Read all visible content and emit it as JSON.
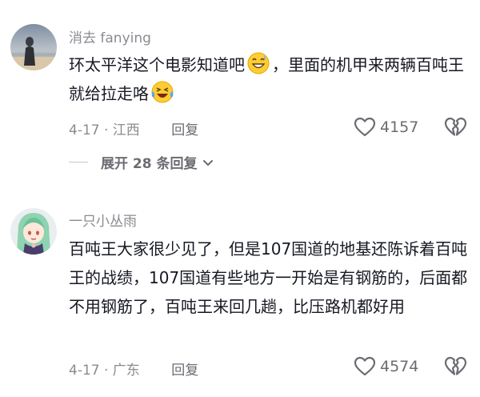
{
  "comments": [
    {
      "username": "消去 fanying",
      "text_part1": "环太平洋这个电影知道吧",
      "emoji1": "grinning-sweat-emoji",
      "text_part2": "，里面的机甲来两辆百吨王就给拉走咯",
      "emoji2": "laughing-crying-emoji",
      "date_location": "4-17 · 江西",
      "reply_label": "回复",
      "like_count": "4157",
      "expand_label": "展开 28 条回复"
    },
    {
      "username": "一只小丛雨",
      "text": "百吨王大家很少见了，但是107国道的地基还陈诉着百吨王的战绩，107国道有些地方一开始是有钢筋的，后面都不用钢筋了，百吨王来回几趟，比压路机都好用",
      "date_location": "4-17 · 广东",
      "reply_label": "回复",
      "like_count": "4574"
    }
  ],
  "icons": {
    "like": "heart-outline-icon",
    "dislike": "broken-heart-icon",
    "expand": "chevron-down-icon"
  },
  "colors": {
    "text_primary": "#161823",
    "text_secondary": "#8a8b91",
    "background": "#ffffff"
  }
}
